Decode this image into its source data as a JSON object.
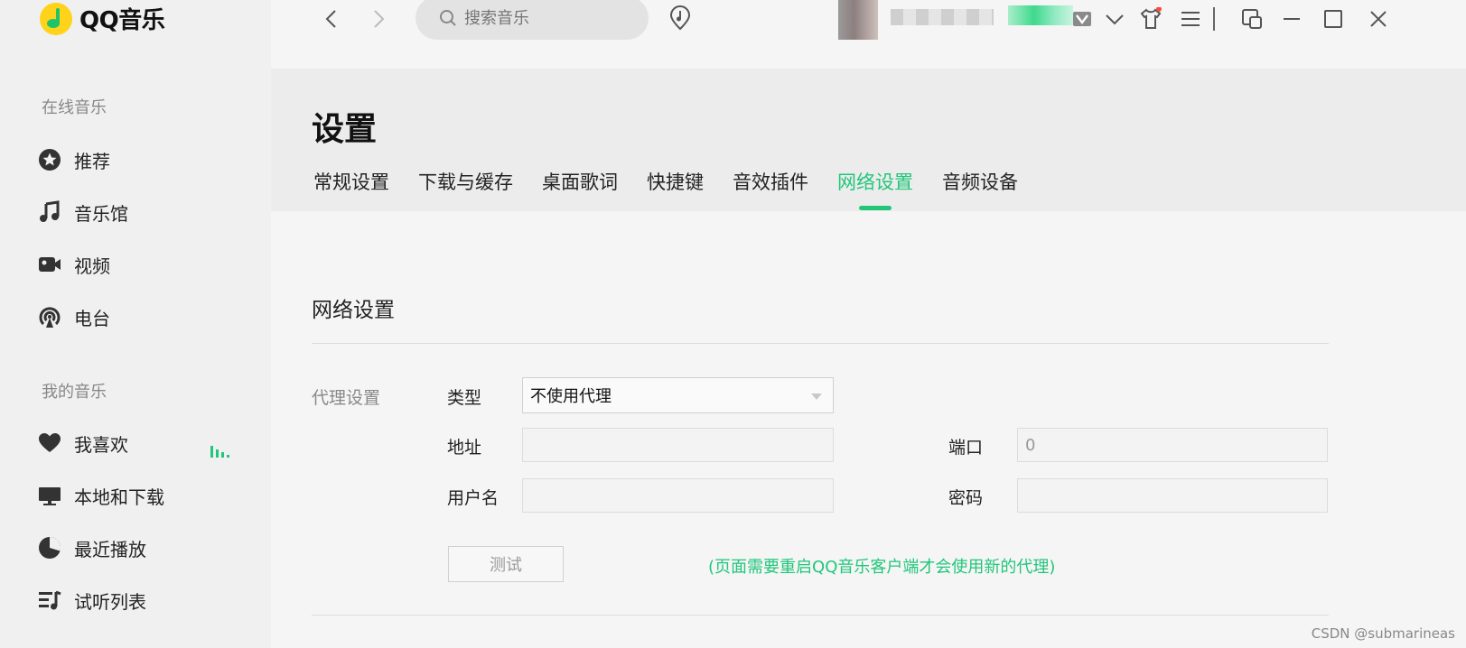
{
  "app": {
    "name": "QQ音乐"
  },
  "sidebar": {
    "sections": [
      {
        "title": "在线音乐",
        "items": [
          {
            "label": "推荐",
            "icon": "star-icon"
          },
          {
            "label": "音乐馆",
            "icon": "music-note-icon"
          },
          {
            "label": "视频",
            "icon": "video-icon"
          },
          {
            "label": "电台",
            "icon": "radio-icon"
          }
        ]
      },
      {
        "title": "我的音乐",
        "items": [
          {
            "label": "我喜欢",
            "icon": "heart-icon"
          },
          {
            "label": "本地和下载",
            "icon": "monitor-icon"
          },
          {
            "label": "最近播放",
            "icon": "clock-icon"
          },
          {
            "label": "试听列表",
            "icon": "playlist-icon"
          }
        ]
      }
    ]
  },
  "topbar": {
    "search_placeholder": "搜索音乐"
  },
  "page": {
    "title": "设置",
    "tabs": [
      "常规设置",
      "下载与缓存",
      "桌面歌词",
      "快捷键",
      "音效插件",
      "网络设置",
      "音频设备"
    ],
    "active_tab": "网络设置"
  },
  "network": {
    "section_title": "网络设置",
    "group_label": "代理设置",
    "type_label": "类型",
    "type_value": "不使用代理",
    "address_label": "地址",
    "address_value": "",
    "port_label": "端口",
    "port_value": "0",
    "username_label": "用户名",
    "username_value": "",
    "password_label": "密码",
    "password_value": "",
    "test_button": "测试",
    "hint": "(页面需要重启QQ音乐客户端才会使用新的代理)"
  },
  "watermark": "CSDN @submarineas",
  "colors": {
    "accent": "#21c67a",
    "logo_yellow": "#ffd31a"
  }
}
